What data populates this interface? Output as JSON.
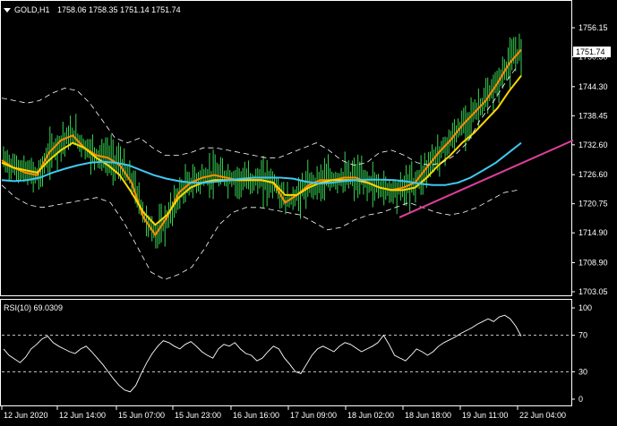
{
  "header": {
    "symbol": "GOLD,H1",
    "ohlc": "1758.06 1758.35 1751.14 1751.74",
    "collapse_icon": "triangle-down-icon"
  },
  "price_badge": "1751.74",
  "rsi_header": "RSI(10) 69.0309",
  "colors": {
    "background": "#000000",
    "grid": "#ffffff",
    "candle": "#39d353",
    "ema_fast": "#ff8c00",
    "ema_slow": "#ffd700",
    "sma_long": "#40c8f0",
    "bollinger": "#ffffff",
    "trendline": "#e0409a",
    "rsi_line": "#ffffff"
  },
  "chart_data": [
    {
      "type": "line",
      "title": "GOLD,H1",
      "x": [
        "12 Jun 2020",
        "12 Jun 14:00",
        "15 Jun 07:00",
        "15 Jun 23:00",
        "16 Jun 16:00",
        "17 Jun 09:00",
        "18 Jun 02:00",
        "18 Jun 18:00",
        "19 Jun 11:00",
        "22 Jun 04:00"
      ],
      "y_ticks": [
        "1756.15",
        "1750.30",
        "1744.30",
        "1738.45",
        "1732.60",
        "1726.60",
        "1720.75",
        "1714.90",
        "1708.90",
        "1703.05"
      ],
      "ylim": [
        1703.05,
        1756.15
      ],
      "last_price": 1751.74,
      "series": [
        {
          "values": [
            1729.5,
            1728.0,
            1727.0,
            1726.5,
            1731.0,
            1733.5,
            1734.5,
            1732.0,
            1730.5,
            1730.0,
            1728.5,
            1725.0,
            1718.0,
            1714.5,
            1718.0,
            1723.0,
            1725.0,
            1726.0,
            1726.5,
            1726.0,
            1725.5,
            1725.5,
            1725.5,
            1725.0,
            1721.0,
            1722.5,
            1724.5,
            1725.5,
            1725.5,
            1726.0,
            1726.0,
            1725.0,
            1724.0,
            1723.5,
            1724.0,
            1725.0,
            1728.0,
            1731.0,
            1733.5,
            1736.5,
            1739.0,
            1741.5,
            1745.0,
            1749.0,
            1751.74
          ]
        },
        {
          "values": [
            1729.0,
            1728.0,
            1727.5,
            1727.0,
            1729.5,
            1731.5,
            1733.0,
            1732.0,
            1730.0,
            1728.5,
            1726.5,
            1723.0,
            1719.0,
            1716.5,
            1718.5,
            1722.0,
            1724.0,
            1725.0,
            1725.5,
            1725.5,
            1725.5,
            1725.5,
            1725.5,
            1725.0,
            1722.5,
            1722.5,
            1724.0,
            1725.0,
            1725.5,
            1725.5,
            1725.5,
            1725.0,
            1724.0,
            1723.5,
            1723.5,
            1724.0,
            1726.0,
            1728.5,
            1730.5,
            1733.0,
            1735.0,
            1737.5,
            1740.0,
            1743.5,
            1746.5
          ]
        },
        {
          "values": [
            1725.5,
            1725.3,
            1725.5,
            1726.0,
            1727.0,
            1727.8,
            1728.5,
            1729.0,
            1729.2,
            1729.0,
            1728.5,
            1727.5,
            1726.5,
            1725.8,
            1725.3,
            1725.0,
            1725.0,
            1725.2,
            1725.5,
            1725.8,
            1726.0,
            1726.0,
            1726.0,
            1725.8,
            1725.2,
            1724.8,
            1725.0,
            1725.3,
            1725.5,
            1725.6,
            1725.6,
            1725.5,
            1725.2,
            1724.8,
            1724.5,
            1724.5,
            1725.0,
            1726.0,
            1727.5,
            1729.0,
            1731.0,
            1733.0
          ]
        },
        {
          "values": [
            1742.0,
            1741.5,
            1741.0,
            1741.5,
            1743.0,
            1744.0,
            1743.5,
            1741.0,
            1737.5,
            1734.0,
            1733.0,
            1734.0,
            1732.0,
            1730.5,
            1730.5,
            1731.0,
            1732.0,
            1732.0,
            1731.5,
            1731.0,
            1730.5,
            1730.0,
            1730.0,
            1731.0,
            1732.0,
            1733.0,
            1731.5,
            1729.5,
            1728.5,
            1729.0,
            1731.0,
            1731.5,
            1730.5,
            1729.0,
            1728.5,
            1729.0,
            1730.5,
            1733.0,
            1737.5,
            1741.0,
            1745.0,
            1748.5
          ]
        },
        {
          "values": [
            1724.5,
            1722.0,
            1720.5,
            1720.0,
            1720.5,
            1721.0,
            1721.5,
            1722.0,
            1721.0,
            1717.0,
            1712.0,
            1707.0,
            1705.5,
            1706.5,
            1708.0,
            1712.0,
            1716.5,
            1719.0,
            1720.0,
            1720.0,
            1719.5,
            1719.0,
            1718.5,
            1717.0,
            1715.5,
            1716.0,
            1717.5,
            1718.5,
            1719.0,
            1720.0,
            1721.0,
            1720.0,
            1719.0,
            1718.5,
            1719.0,
            1720.0,
            1721.5,
            1723.0,
            1723.5
          ]
        },
        {
          "name": "",
          "values": [
            1718.0,
            1733.5
          ]
        }
      ],
      "trendline_x": [
        "18 Jun 02:00",
        "22 Jun 04:00"
      ]
    },
    {
      "type": "line",
      "title": "RSI(10) 69.0309",
      "x": [
        "12 Jun 2020",
        "12 Jun 14:00",
        "15 Jun 07:00",
        "15 Jun 23:00",
        "16 Jun 16:00",
        "17 Jun 09:00",
        "18 Jun 02:00",
        "18 Jun 18:00",
        "19 Jun 11:00",
        "22 Jun 04:00"
      ],
      "y_ticks": [
        "100",
        "70",
        "30",
        "0"
      ],
      "ylim": [
        0,
        100
      ],
      "levels": [
        70,
        30
      ],
      "series": [
        {
          "values": [
            55,
            48,
            44,
            40,
            46,
            55,
            60,
            66,
            69,
            62,
            58,
            55,
            52,
            50,
            55,
            58,
            52,
            45,
            38,
            30,
            22,
            15,
            10,
            8,
            15,
            28,
            40,
            50,
            58,
            64,
            62,
            58,
            55,
            60,
            63,
            58,
            52,
            48,
            45,
            55,
            60,
            58,
            62,
            55,
            50,
            48,
            42,
            45,
            52,
            58,
            55,
            45,
            38,
            30,
            28,
            38,
            48,
            55,
            58,
            55,
            52,
            58,
            62,
            60,
            56,
            52,
            55,
            58,
            62,
            70,
            60,
            48,
            45,
            42,
            48,
            55,
            52,
            48,
            52,
            58,
            62,
            65,
            68,
            72,
            75,
            78,
            82,
            85,
            88,
            85,
            90,
            92,
            88,
            80,
            69
          ]
        }
      ]
    }
  ]
}
